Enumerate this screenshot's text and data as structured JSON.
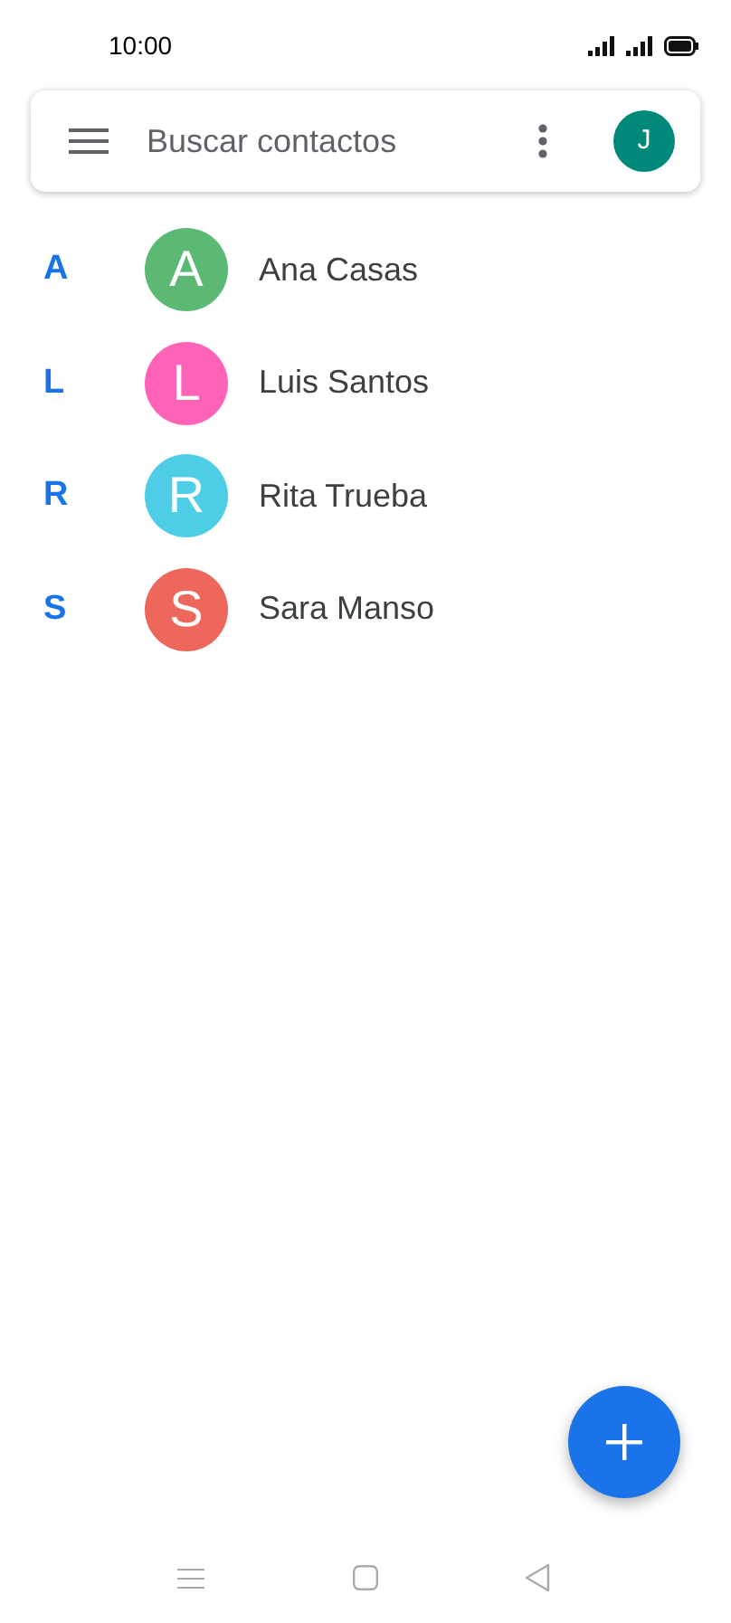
{
  "status_bar": {
    "time": "10:00"
  },
  "search": {
    "placeholder": "Buscar contactos",
    "account_initial": "J"
  },
  "contacts": [
    {
      "section": "A",
      "initial": "A",
      "name": "Ana Casas",
      "color": "#5bb974"
    },
    {
      "section": "L",
      "initial": "L",
      "name": "Luis Santos",
      "color": "#ff63b8"
    },
    {
      "section": "R",
      "initial": "R",
      "name": "Rita Trueba",
      "color": "#4ecde6"
    },
    {
      "section": "S",
      "initial": "S",
      "name": "Sara Manso",
      "color": "#ee675c"
    }
  ]
}
